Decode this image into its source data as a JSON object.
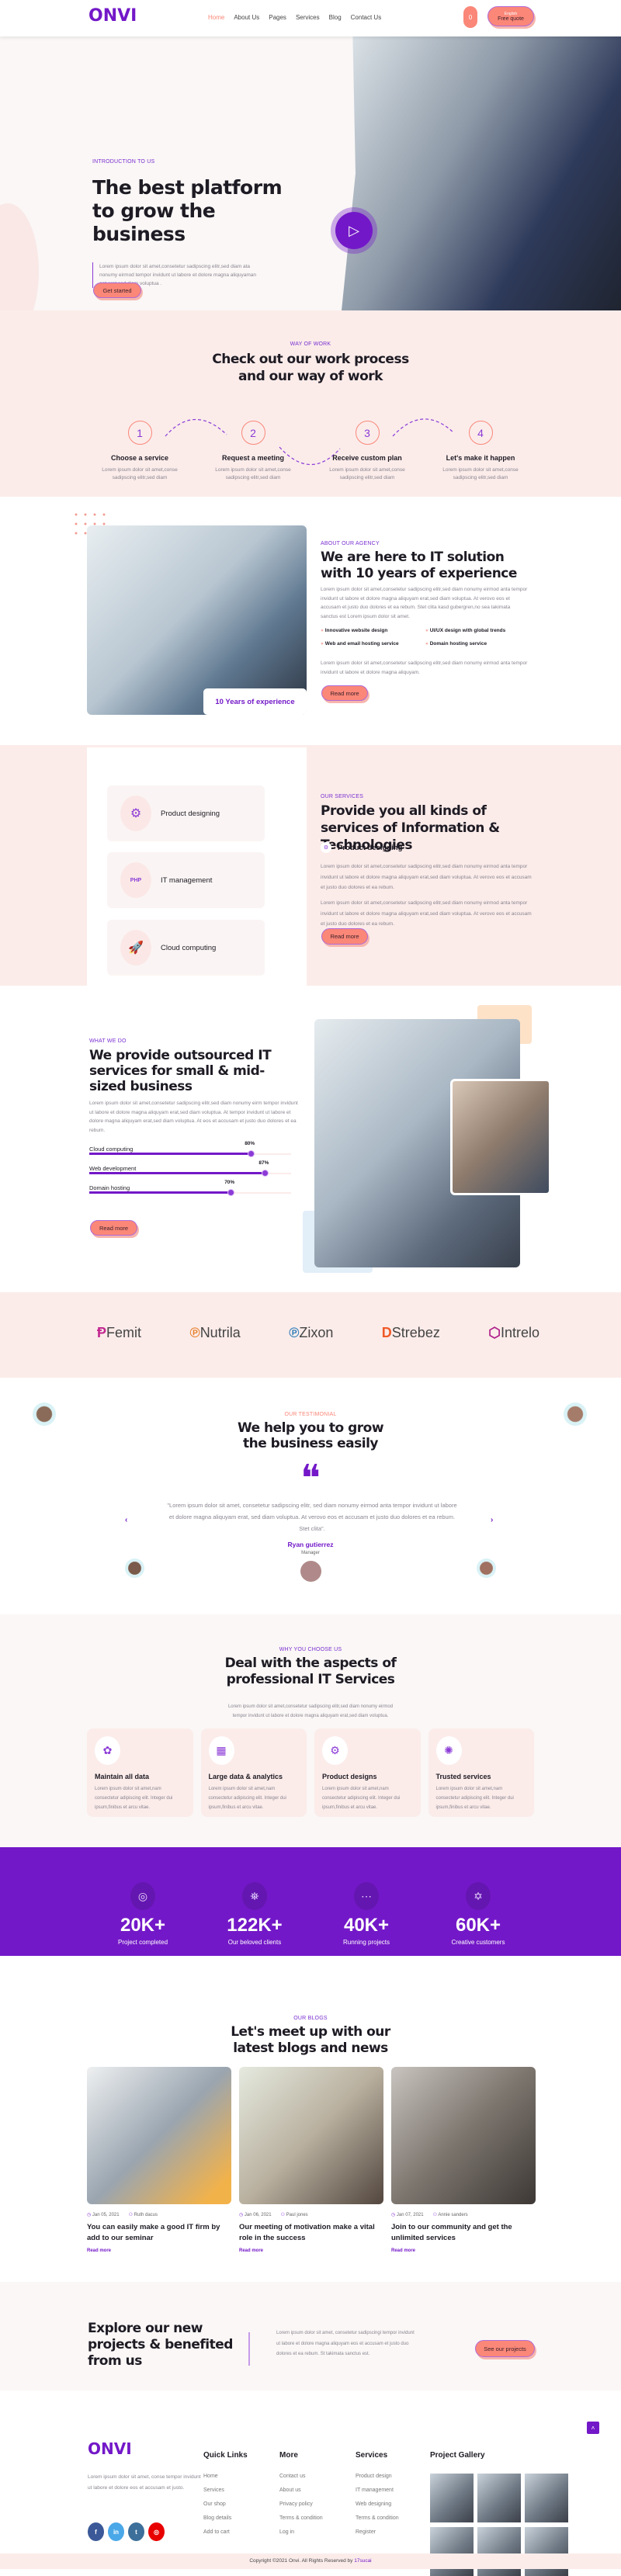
{
  "header": {
    "logo": "ONVI",
    "nav": [
      "Home",
      "About Us",
      "Pages",
      "Services",
      "Blog",
      "Contact Us"
    ],
    "cart_count": "0",
    "language": "English",
    "quote": "Free quote"
  },
  "hero": {
    "tag": "INTRODUCTION TO US",
    "title": "The best platform to grow the business",
    "text": "Lorem ipsum dolor sit amet,consetetur sadipscing elitr,sed diam ata nonumy eirmod tempor invidunt ut labore et dolore magna aliquyaman ant erat,sed diam voluptua .",
    "button": "Get started"
  },
  "process": {
    "tag": "WAY OF WORK",
    "title": "Check out our work process and our way of work",
    "steps": [
      {
        "n": "1",
        "title": "Choose a service",
        "text": "Lorem ipsum dolor sit amet,conse sadipscing elitr,sed diam"
      },
      {
        "n": "2",
        "title": "Request a meeting",
        "text": "Lorem ipsum dolor sit amet,conse sadipscing elitr,sed diam"
      },
      {
        "n": "3",
        "title": "Receive custom plan",
        "text": "Lorem ipsum dolor sit amet,conse sadipscing elitr,sed diam"
      },
      {
        "n": "4",
        "title": "Let's make it happen",
        "text": "Lorem ipsum dolor sit amet,conse sadipscing elitr,sed diam"
      }
    ]
  },
  "about": {
    "badge": "10 Years of experience",
    "tag": "ABOUT OUR AGENCY",
    "title": "We are here to IT solution with 10 years of experience",
    "text1": "Lorem ipsum dolor sit amet,consetetur sadipscing elitr,sed diam nonumy eirmod anta tempor invidunt ut labore et dolore magna aliquyam erat,sed diam voluptua. At verovo eos et accusam et justo duo dolores et ea rebum. Stet clita kasd gubergren,no sea takimata sanctus est Lorem ipsum dolor sit amet.",
    "features": [
      "Innovative website design",
      "UI/UX design with global trends",
      "Web and email hosting service",
      "Domain hosting service"
    ],
    "text2": "Lorem ipsum dolor sit amet,consetetur sadipscing elitr,sed diam nonumy eirmod anta tempor invidunt ut labore et dolore magna aliquyam.",
    "button": "Read more"
  },
  "services": {
    "items": [
      "Product designing",
      "IT management",
      "Cloud computing"
    ],
    "tag": "OUR SERVICES",
    "title": "Provide you all kinds of services of Information & Technologies",
    "active": "Product designing",
    "text1": "Lorem ipsum dolor sit amet,consetetur sadipscing elitr,sed diam nonumy eirmod anta tempor invidunt ut labore et dolore magna aliquyam erat,sed diam voluptua. At verovo eos et accusam et justo duo dolores et ea rebum.",
    "text2": "Lorem ipsum dolor sit amet,consetetur sadipscing elitr,sed diam nonumy eirmod anta tempor invidunt ut labore et dolore magna aliquyam erat,sed diam voluptua. At verovo eos et accusam et justo duo dolores et ea rebum.",
    "button": "Read more"
  },
  "whatwedo": {
    "tag": "WHAT WE DO",
    "title": "We provide outsourced IT services for small & mid-sized business",
    "text": "Lorem ipsum dolor sit amet,consetetur sadipscing elitr,sed diam nonumy eirm tempor invidunt ut labore et dolore magna aliquyam erat,sed diam voluptua. At tempor invidunt ut labore et dolore magna aliquyam erat,sed diam voluptua. At eos et accusam et justo duo dolores et ea rebum.",
    "skills": [
      {
        "name": "Cloud computing",
        "pct": 80,
        "label": "80%"
      },
      {
        "name": "Web development",
        "pct": 87,
        "label": "87%"
      },
      {
        "name": "Domain hosting",
        "pct": 70,
        "label": "70%"
      }
    ],
    "button": "Read more"
  },
  "brands": [
    "Femit",
    "Nutrila",
    "Zixon",
    "Strebez",
    "Intrelo"
  ],
  "testimonial": {
    "tag": "OUR TESTIMONIAL",
    "title": "We help you to grow the business easily",
    "quote": "\"Lorem ipsum dolor sit amet, consetetur sadipscing elitr, sed diam nonumy eirmod anta tempor invidunt ut labore et dolore magna aliquyam erat, sed diam voluptua. At verovo eos et accusam et justo duo dolores et ea rebum. Stet clita\".",
    "name": "Ryan gutierrez",
    "role": "Manager"
  },
  "why": {
    "tag": "WHY YOU CHOOSE US",
    "title": "Deal with the aspects of professional IT Services",
    "text": "Lorem ipsum dolor sit amet,consetetur sadipscing elitr,sed diam nonumy eirmod tempor invidunt ut labore et dolore magna aliquyam erat,sed diam voluptua.",
    "cards": [
      {
        "title": "Maintain all data",
        "text": "Lorem ipsum dolor sit amet,nam consectetur adipiscing elit. Integer dui ipsum,finibus et arcu vitae."
      },
      {
        "title": "Large data & analytics",
        "text": "Lorem ipsum dolor sit amet,nam consectetur adipiscing elit. Integer dui ipsum,finibus et arcu vitae."
      },
      {
        "title": "Product designs",
        "text": "Lorem ipsum dolor sit amet,nam consectetur adipiscing elit. Integer dui ipsum,finibus et arcu vitae."
      },
      {
        "title": "Trusted services",
        "text": "Lorem ipsum dolor sit amet,nam consectetur adipiscing elit. Integer dui ipsum,finibus et arcu vitae."
      }
    ]
  },
  "stats": [
    {
      "value": "20K+",
      "label": "Project completed",
      "icon": "◎"
    },
    {
      "value": "122K+",
      "label": "Our beloved clients",
      "icon": "⛯"
    },
    {
      "value": "40K+",
      "label": "Running projects",
      "icon": "⋯"
    },
    {
      "value": "60K+",
      "label": "Creative customers",
      "icon": "✡"
    }
  ],
  "blogs": {
    "tag": "OUR BLOGS",
    "title": "Let's meet up with our latest blogs and news",
    "posts": [
      {
        "date": "Jan 05, 2021",
        "author": "Ruth dacus",
        "title": "You can easily make a good IT firm by add to our seminar",
        "link": "Read more"
      },
      {
        "date": "Jan 06, 2021",
        "author": "Paul jones",
        "title": "Our meeting of motivation make a vital role in the success",
        "link": "Read more"
      },
      {
        "date": "Jan 07, 2021",
        "author": "Annie sanders",
        "title": "Join to our community and get the unlimited services",
        "link": "Read more"
      }
    ]
  },
  "cta": {
    "title": "Explore our new projects & benefited from us",
    "text": "Lorem ipsum dolor sit amet, consetetur sadipscingi tempor invidunt ut labore et dolore magna aliquyam eos et accusam et justo duo dolores et ea rebum. St takimata sanctus est.",
    "button": "See our projects"
  },
  "footer": {
    "logo": "ONVI",
    "about": "Lorem ipsum dolor sit amet, conse tempor invidunt ut labore et dolore eos et accusam et justo.",
    "cols": [
      {
        "title": "Quick Links",
        "links": [
          "Home",
          "Services",
          "Our shop",
          "Blog details",
          "Add to cart"
        ]
      },
      {
        "title": "More",
        "links": [
          "Contact us",
          "About us",
          "Privacy policy",
          "Terms & condition",
          "Log in"
        ]
      },
      {
        "title": "Services",
        "links": [
          "Product design",
          "IT management",
          "Web designing",
          "Terms & condition",
          "Register"
        ]
      }
    ],
    "gallery_title": "Project Gallery",
    "copyright": "Copyright ©2021 Onvi. All Rights Reserved by ",
    "credit": "17sucai"
  },
  "colors": {
    "primary": "#7318c8",
    "accent": "#fa8778",
    "pink_bg": "#fbecea"
  }
}
